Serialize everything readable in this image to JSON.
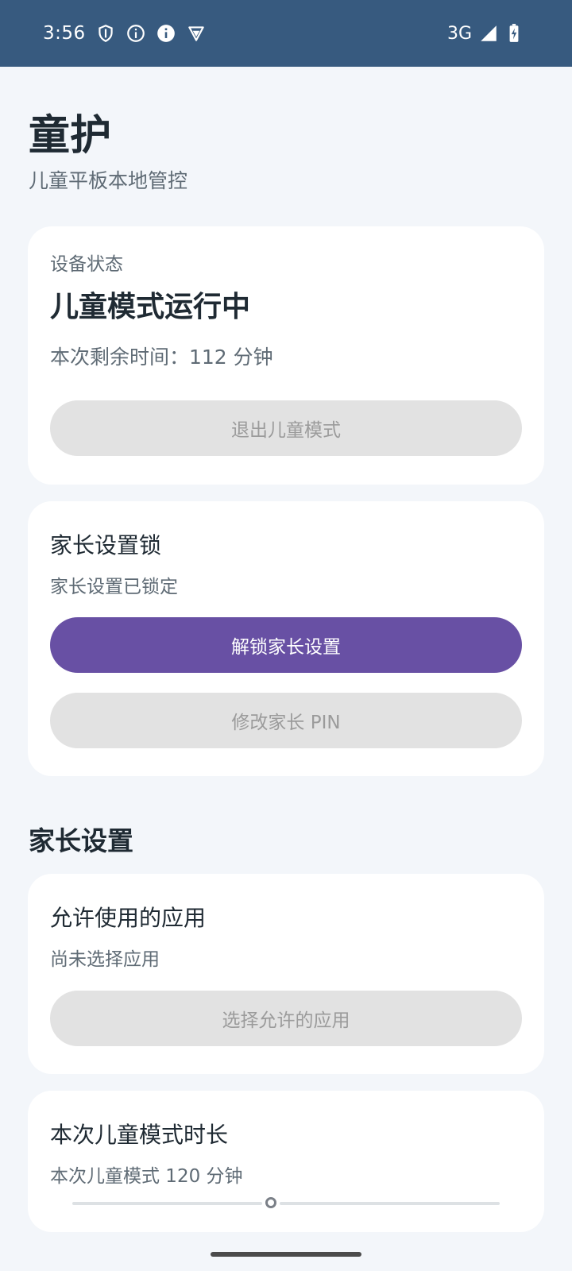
{
  "status_bar": {
    "time": "3:56",
    "network": "3G",
    "left_icons": [
      "shield-outline-icon",
      "info-outline-icon",
      "info-filled-icon",
      "vpn-shield-icon"
    ],
    "right_icons": [
      "signal-icon",
      "battery-charging-icon"
    ]
  },
  "app": {
    "title": "童护",
    "subtitle": "儿童平板本地管控"
  },
  "device_status_card": {
    "label": "设备状态",
    "heading": "儿童模式运行中",
    "remaining": "本次剩余时间：112 分钟",
    "exit_button": "退出儿童模式"
  },
  "parent_lock_card": {
    "title": "家长设置锁",
    "status": "家长设置已锁定",
    "unlock_button": "解锁家长设置",
    "change_pin_button": "修改家长 PIN"
  },
  "parent_settings": {
    "section_title": "家长设置",
    "apps_card": {
      "title": "允许使用的应用",
      "status": "尚未选择应用",
      "select_button": "选择允许的应用"
    },
    "duration_card": {
      "title": "本次儿童模式时长",
      "value_text": "本次儿童模式 120 分钟",
      "slider_fraction": 0.465
    }
  },
  "colors": {
    "status_bar_bg": "#375a7f",
    "page_bg": "#f3f6fa",
    "card_bg": "#ffffff",
    "primary": "#6850a4",
    "disabled_button_bg": "#e2e2e2",
    "disabled_button_text": "#9b9b9b"
  }
}
